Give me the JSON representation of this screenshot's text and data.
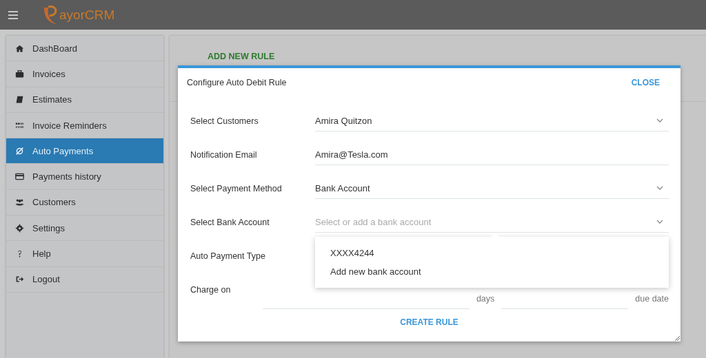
{
  "header": {
    "logo_text": "ayorCRM"
  },
  "sidebar": {
    "items": [
      {
        "label": "DashBoard",
        "selected": false
      },
      {
        "label": "Invoices",
        "selected": false
      },
      {
        "label": "Estimates",
        "selected": false
      },
      {
        "label": "Invoice Reminders",
        "selected": false
      },
      {
        "label": "Auto Payments",
        "selected": true
      },
      {
        "label": "Payments history",
        "selected": false
      },
      {
        "label": "Customers",
        "selected": false
      },
      {
        "label": "Settings",
        "selected": false
      },
      {
        "label": "Help",
        "selected": false
      },
      {
        "label": "Logout",
        "selected": false
      }
    ]
  },
  "page": {
    "heading": "ADD NEW RULE"
  },
  "dialog": {
    "title": "Configure Auto Debit Rule",
    "close": "CLOSE",
    "fields": [
      {
        "label": "Select Customers",
        "kind": "select",
        "value": "Amira Quitzon"
      },
      {
        "label": "Notification Email",
        "kind": "text",
        "value": "Amira@Tesla.com"
      },
      {
        "label": "Select Payment Method",
        "kind": "select",
        "value": "Bank Account"
      },
      {
        "label": "Select Bank Account",
        "kind": "select",
        "placeholder": "Select or add a bank account",
        "expanded": true,
        "options": [
          "XXXX4244",
          "Add new bank account"
        ]
      },
      {
        "label": "Auto Payment Type",
        "kind": "covered"
      },
      {
        "label": "Charge on",
        "kind": "charge",
        "unit": "days",
        "suffix": "due date"
      }
    ],
    "submit": "CREATE RULE"
  }
}
